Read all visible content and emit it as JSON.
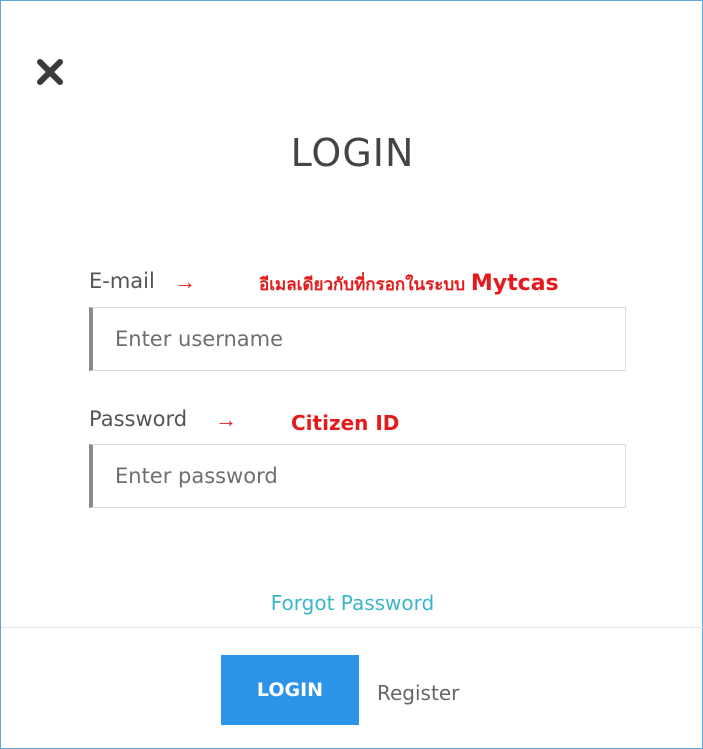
{
  "dialog": {
    "close_icon": "close-x-icon",
    "title": "LOGIN"
  },
  "email_field": {
    "label": "E-mail",
    "arrow": "→",
    "annotation_text": "อีเมลเดียวกับที่กรอกในระบบ",
    "annotation_brand": "Mytcas",
    "placeholder": "Enter username"
  },
  "password_field": {
    "label": "Password",
    "arrow": "→",
    "annotation_text": "Citizen ID",
    "placeholder": "Enter password"
  },
  "links": {
    "forgot_password": "Forgot Password",
    "register": "Register"
  },
  "buttons": {
    "login": "LOGIN"
  },
  "colors": {
    "annotation": "#e51b1b",
    "link": "#3ab6c9",
    "primary_button": "#2b94e8",
    "border": "#5ea6df"
  }
}
